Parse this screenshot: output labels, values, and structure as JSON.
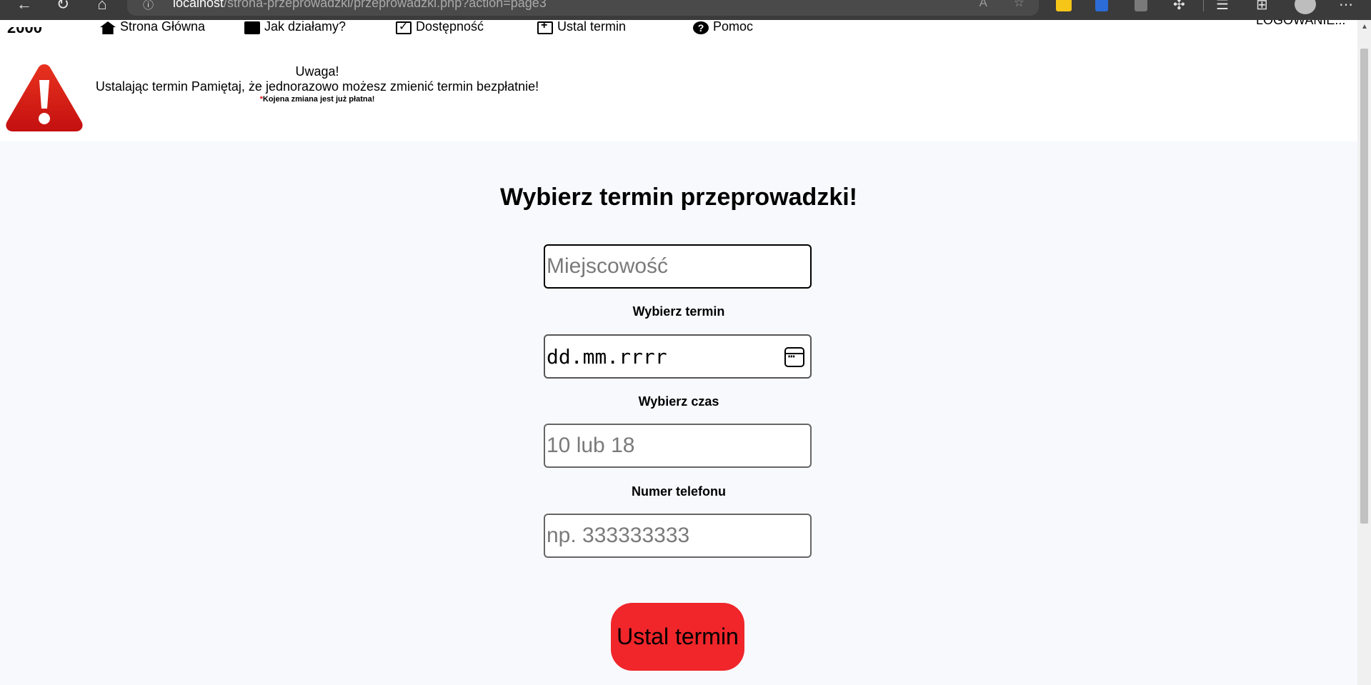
{
  "browser": {
    "url_host": "localhost",
    "url_path": "/strona-przeprowadzki/przeprowadzki.php?action=page3",
    "icons": [
      "back-icon",
      "reload-icon",
      "home-icon",
      "info-icon",
      "read-aloud-icon",
      "add-favorite-icon",
      "extension-icon",
      "translate-icon",
      "extension-icon",
      "puzzle-icon",
      "favorites-icon",
      "collections-icon",
      "profile-icon",
      "more-icon"
    ]
  },
  "nav": {
    "logo": "2000",
    "items": [
      {
        "label": "Strona Główna",
        "icon": "home-icon"
      },
      {
        "label": "Jak działamy?",
        "icon": "briefcase-icon"
      },
      {
        "label": "Dostępność",
        "icon": "checkbox-icon"
      },
      {
        "label": "Ustal termin",
        "icon": "plus-square-icon"
      },
      {
        "label": "Pomoc",
        "icon": "help-icon"
      }
    ],
    "login": "LOGOWANIE..."
  },
  "banner": {
    "heading": "Uwaga!",
    "text": "Ustalając termin Pamiętaj, że jednorazowo możesz zmienić termin bezpłatnie!",
    "note_star": "*",
    "note": "Kojena zmiana jest już płatna!"
  },
  "form": {
    "title": "Wybierz termin przeprowadzki!",
    "city_placeholder": "Miejscowość",
    "date_label": "Wybierz termin",
    "date_placeholder": "dd.mm.rrrr",
    "time_label": "Wybierz czas",
    "time_placeholder": "10 lub 18",
    "phone_label": "Numer telefonu",
    "phone_placeholder": "np. 333333333",
    "submit": "Ustal termin"
  },
  "colors": {
    "submit_bg": "#f0262a",
    "warning_red": "#d81b1b",
    "page_bg": "#f8f9fd"
  }
}
